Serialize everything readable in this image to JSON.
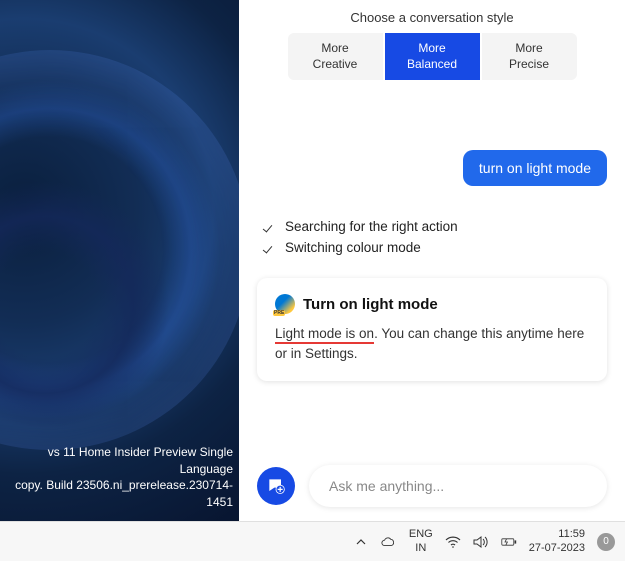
{
  "desktop": {
    "watermark_line1": "vs 11 Home Insider Preview Single Language",
    "watermark_line2": "copy. Build 23506.ni_prerelease.230714-1451"
  },
  "copilot": {
    "style_header": "Choose a conversation style",
    "styles": [
      {
        "line1": "More",
        "line2": "Creative",
        "selected": false
      },
      {
        "line1": "More",
        "line2": "Balanced",
        "selected": true
      },
      {
        "line1": "More",
        "line2": "Precise",
        "selected": false
      }
    ],
    "user_message": "turn on light mode",
    "status": [
      "Searching for the right action",
      "Switching colour mode"
    ],
    "card": {
      "title": "Turn on light mode",
      "highlighted": "Light mode is on",
      "rest": ". You can change this anytime here or in Settings."
    },
    "input_placeholder": "Ask me anything..."
  },
  "taskbar": {
    "lang_top": "ENG",
    "lang_bottom": "IN",
    "time": "11:59",
    "date": "27-07-2023",
    "notif_count": "0"
  }
}
